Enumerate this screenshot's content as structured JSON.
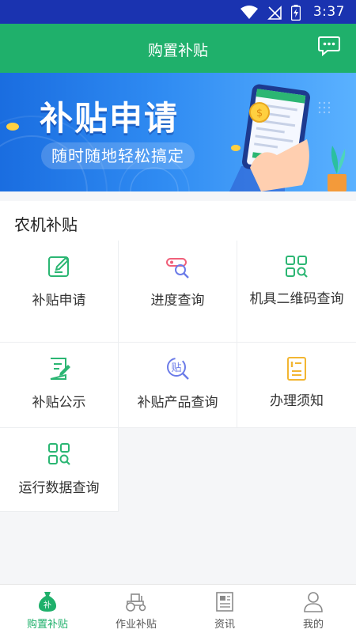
{
  "status_bar": {
    "time": "3:37"
  },
  "app_bar": {
    "title": "购置补贴",
    "message_icon": "chat-bubble-icon"
  },
  "banner": {
    "title": "补贴申请",
    "subtitle": "随时随地轻松搞定"
  },
  "section": {
    "title": "农机补贴"
  },
  "grid_items": [
    {
      "label": "补贴申请",
      "icon": "edit-icon",
      "color": "#2bb673"
    },
    {
      "label": "进度查询",
      "icon": "progress-search-icon",
      "color": "#f0607a"
    },
    {
      "label": "机具二维码查询",
      "icon": "qr-grid-search-icon",
      "color": "#2bb673"
    },
    {
      "label": "补贴公示",
      "icon": "notice-edit-icon",
      "color": "#2bb673"
    },
    {
      "label": "补贴产品查询",
      "icon": "subsidy-search-icon",
      "color": "#6b7be8",
      "glyph": "贴"
    },
    {
      "label": "办理须知",
      "icon": "notice-list-icon",
      "color": "#f2b632"
    },
    {
      "label": "运行数据查询",
      "icon": "data-grid-search-icon",
      "color": "#2bb673"
    }
  ],
  "tabs": [
    {
      "label": "购置补贴",
      "icon": "money-bag-icon",
      "active": true,
      "glyph": "补"
    },
    {
      "label": "作业补贴",
      "icon": "tractor-icon",
      "active": false
    },
    {
      "label": "资讯",
      "icon": "news-icon",
      "active": false
    },
    {
      "label": "我的",
      "icon": "user-icon",
      "active": false
    }
  ],
  "colors": {
    "status_bar": "#1a33b0",
    "brand_green": "#1fb06b",
    "banner_blue": "#2f8bf2"
  }
}
